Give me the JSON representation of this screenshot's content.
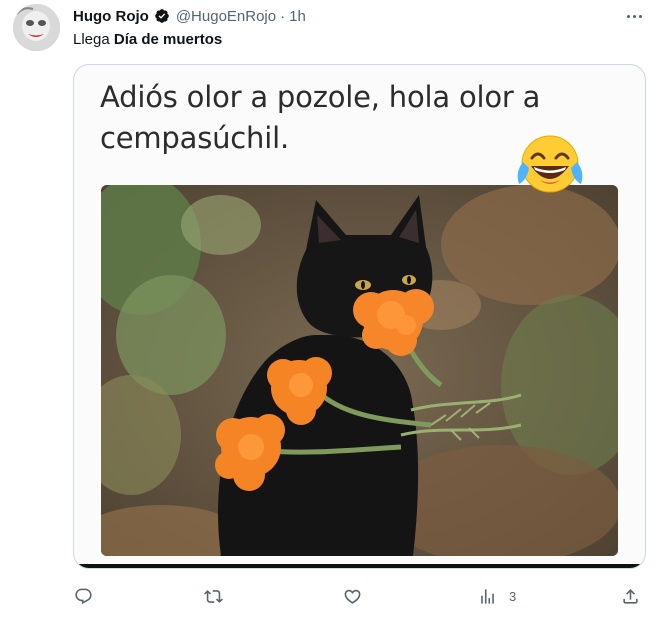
{
  "tweet": {
    "display_name": "Hugo Rojo",
    "handle": "@HugoEnRojo",
    "separator": "·",
    "time": "1h",
    "text_prefix": "Llega ",
    "text_bold": "Día de muertos"
  },
  "media": {
    "caption": "Adiós olor a pozole, hola olor a cempasúchil."
  },
  "actions": {
    "views_count": "3"
  },
  "icons": {
    "verified": "verified-badge-icon",
    "more": "more-horizontal-icon",
    "reply": "reply-icon",
    "retweet": "retweet-icon",
    "like": "heart-icon",
    "views": "views-bar-chart-icon",
    "share": "share-upload-icon",
    "emoji": "tears-of-joy-emoji"
  },
  "colors": {
    "text_primary": "#0f1419",
    "text_secondary": "#536471",
    "border": "#cfd9de",
    "marigold": "#f7862a"
  }
}
